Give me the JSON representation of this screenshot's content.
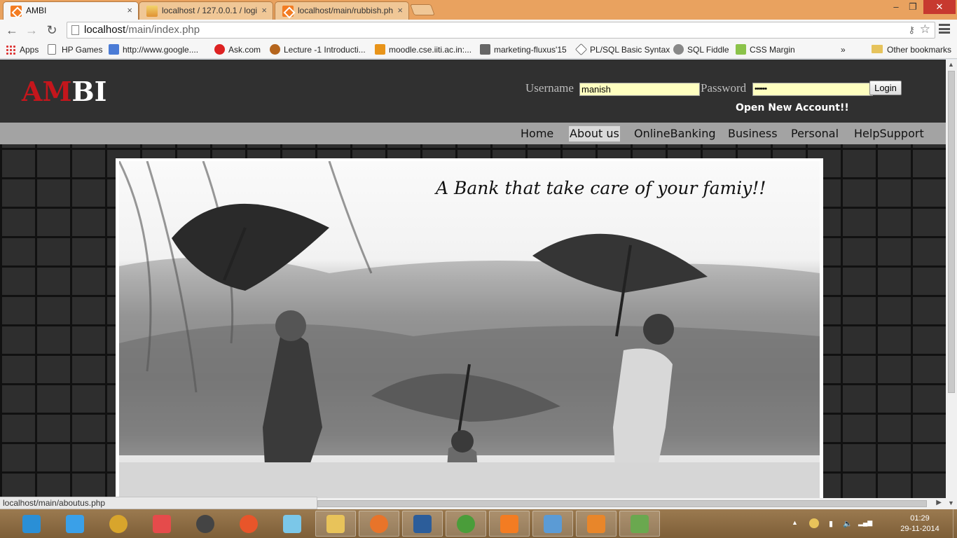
{
  "browser": {
    "tabs": [
      {
        "title": "AMBI",
        "active": true
      },
      {
        "title": "localhost / 127.0.0.1 / logi",
        "active": false
      },
      {
        "title": "localhost/main/rubbish.ph",
        "active": false
      }
    ],
    "tab_close_glyph": "×",
    "window_controls": {
      "minimize": "–",
      "maximize": "❐",
      "close": "✕"
    },
    "address_bar": {
      "host": "localhost",
      "path": "/main/index.php"
    },
    "nav_glyphs": {
      "back": "←",
      "forward": "→",
      "reload": "↻"
    },
    "omnibox_glyphs": {
      "key": "⚷",
      "star": "☆"
    },
    "bookmarks": [
      {
        "label": "Apps",
        "icon": "apps-grid-icon"
      },
      {
        "label": "HP Games",
        "icon": "page-icon"
      },
      {
        "label": "http://www.google....",
        "icon": "google-icon"
      },
      {
        "label": "Ask.com",
        "icon": "ask-icon"
      },
      {
        "label": "Lecture -1 Introducti...",
        "icon": "lecture-icon"
      },
      {
        "label": "moodle.cse.iiti.ac.in:...",
        "icon": "moodle-icon"
      },
      {
        "label": "marketing-fluxus'15",
        "icon": "marketing-icon"
      },
      {
        "label": "PL/SQL Basic Syntax",
        "icon": "plsql-icon"
      },
      {
        "label": "SQL Fiddle",
        "icon": "sqlfiddle-icon"
      },
      {
        "label": "CSS Margin",
        "icon": "cssmargin-icon"
      }
    ],
    "bookmarks_overflow": "»",
    "other_bookmarks": "Other bookmarks",
    "status_url": "localhost/main/aboutus.php"
  },
  "site": {
    "logo": {
      "part1": "AM",
      "part2": "BI"
    },
    "login": {
      "username_label": "Username",
      "username_value": "manish",
      "password_label": "Password",
      "password_value": "••••••",
      "button": "Login"
    },
    "open_account": "Open New Account!!",
    "nav": [
      {
        "label": "Home",
        "active": false
      },
      {
        "label": "About us",
        "active": true
      },
      {
        "label": "OnlineBanking",
        "active": false
      },
      {
        "label": "Business",
        "active": false
      },
      {
        "label": "Personal",
        "active": false
      },
      {
        "label": "HelpSupport",
        "active": false
      }
    ],
    "banner_tagline": "A Bank that take care of your famiy!!"
  },
  "taskbar": {
    "apps": [
      {
        "name": "internet-explorer",
        "color": "#2a8fd6"
      },
      {
        "name": "rocket-launcher",
        "color": "#3aa0e8"
      },
      {
        "name": "media-player",
        "color": "#d8a52c"
      },
      {
        "name": "puzzle-app",
        "color": "#e54b4b"
      },
      {
        "name": "hp-app",
        "color": "#444444"
      },
      {
        "name": "browser-orb",
        "color": "#e8552a"
      },
      {
        "name": "notes-app",
        "color": "#7bc7e8"
      },
      {
        "name": "file-explorer",
        "color": "#e8c35a"
      },
      {
        "name": "firefox",
        "color": "#e8742a"
      },
      {
        "name": "network-app",
        "color": "#2c5d9a"
      },
      {
        "name": "chrome",
        "color": "#4a9d3a"
      },
      {
        "name": "xampp",
        "color": "#f37c22"
      },
      {
        "name": "control-panel",
        "color": "#5b9bd5"
      },
      {
        "name": "pdf-app",
        "color": "#e8862a"
      },
      {
        "name": "editor-app",
        "color": "#6aa84f"
      }
    ],
    "tray_glyphs": {
      "up": "▲",
      "battery": "▮",
      "volume": "🔈",
      "signal": "▂▄▆"
    },
    "clock": {
      "time": "01:29",
      "date": "29-11-2014"
    }
  },
  "colors": {
    "logo_red": "#c4161c",
    "header_bg": "#303030",
    "nav_bg": "#a3a3a3",
    "input_bg": "#ffffc0"
  }
}
